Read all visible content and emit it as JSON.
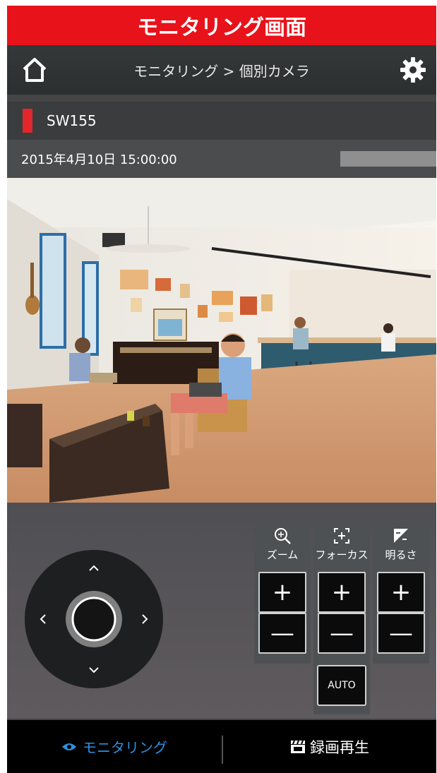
{
  "banner": {
    "title": "モニタリング画面"
  },
  "header": {
    "breadcrumb": "モニタリング > 個別カメラ"
  },
  "camera": {
    "name": "SW155",
    "datetime": "2015年4月10日  15:00:00"
  },
  "controls": {
    "zoom_label": "ズーム",
    "focus_label": "フォーカス",
    "brightness_label": "明るさ",
    "plus": "+",
    "minus": "—",
    "auto_label": "AUTO"
  },
  "footer": {
    "monitoring_tab": "モニタリング",
    "playback_tab": "録画再生"
  },
  "colors": {
    "accent_red": "#e2262b",
    "banner_red": "#e8121a",
    "tab_blue": "#2d8fe0"
  }
}
